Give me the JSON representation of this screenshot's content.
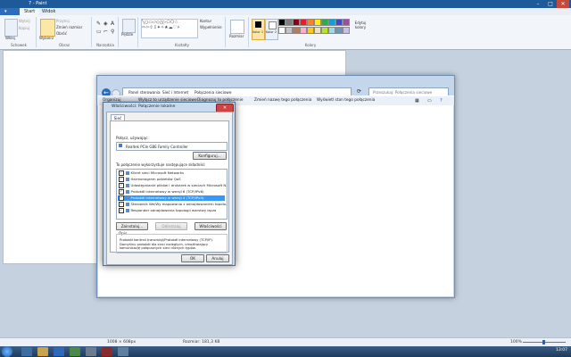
{
  "paint": {
    "title": "7 - Paint",
    "tabs": [
      "Start",
      "Widok"
    ],
    "groups": {
      "clipboard": {
        "label": "Schowek",
        "paste": "Wklej",
        "cut": "Wytnij",
        "copy": "Kopiuj"
      },
      "image": {
        "label": "Obraz",
        "select": "Wybierz",
        "crop": "Przytnij",
        "resize": "Zmień rozmiar",
        "rotate": "Obróć"
      },
      "tools": {
        "label": "Narzędzia"
      },
      "brushes": {
        "label": "Pędzle"
      },
      "shapes": {
        "label": "Kształty",
        "outline": "Kontur",
        "fill": "Wypełnienie"
      },
      "size": {
        "label": "Rozmiar"
      },
      "colors": {
        "label": "Kolory",
        "color1": "Kolor 1",
        "color2": "Kolor 2",
        "edit": "Edytuj kolory"
      }
    },
    "palette": [
      "#000000",
      "#7f7f7f",
      "#880015",
      "#ed1c24",
      "#ff7f27",
      "#fff200",
      "#22b14c",
      "#00a2e8",
      "#3f48cc",
      "#a349a4",
      "#ffffff",
      "#c3c3c3",
      "#b97a57",
      "#ffaec9",
      "#ffc90e",
      "#efe4b0",
      "#b5e61d",
      "#99d9ea",
      "#7092be",
      "#c8bfe7"
    ],
    "status": {
      "size": "1008 × 608px",
      "filesize": "Rozmiar: 181,3 KB",
      "zoom": "100%"
    }
  },
  "explorer": {
    "address": [
      "Panel sterowania",
      "Sieć i Internet",
      "Połączenia sieciowe"
    ],
    "search_placeholder": "Przeszukaj: Połączenia sieciowe",
    "commands": [
      "Organizuj",
      "Wyłącz to urządzenie sieciowe",
      "Diagnozuj to połączenie",
      "Zmień nazwę tego połączenia",
      "Wyświetl stan tego połączenia"
    ]
  },
  "dialog": {
    "title": "Właściwości: Połączenie lokalne",
    "tab": "Sieć",
    "connect_using_label": "Połącz, używając:",
    "adapter": "Realtek PCIe GBE Family Controller",
    "configure": "Konfiguruj...",
    "items_label": "To połączenie wykorzystuje następujące składniki:",
    "items": [
      {
        "label": "Klient sieci Microsoft Networks",
        "checked": true,
        "selected": false
      },
      {
        "label": "Harmonogram pakietów QoS",
        "checked": true,
        "selected": false
      },
      {
        "label": "Udostępnianie plików i drukarek w sieciach Microsoft N...",
        "checked": true,
        "selected": false
      },
      {
        "label": "Protokół internetowy w wersji 6 (TCP/IPv6)",
        "checked": true,
        "selected": false
      },
      {
        "label": "Protokół internetowy w wersji 4 (TCP/IPv4)",
        "checked": true,
        "selected": true
      },
      {
        "label": "Sterownik We/Wy mapowania z odnajdowaniem topolo...",
        "checked": true,
        "selected": false
      },
      {
        "label": "Responder odnajdowania topologii warstwy łącza",
        "checked": true,
        "selected": false
      }
    ],
    "install": "Zainstaluj...",
    "uninstall": "Odinstaluj",
    "properties": "Właściwości",
    "desc_label": "Opis",
    "desc_text": "Protokół kontroli transmisji/Protokół internetowy (TCP/IP). Domyślny protokół dla sieci rozległych, umożliwiający komunikację połączonych sieci różnych typów.",
    "ok": "OK",
    "cancel": "Anuluj"
  },
  "taskbar": {
    "time": "13:07"
  }
}
